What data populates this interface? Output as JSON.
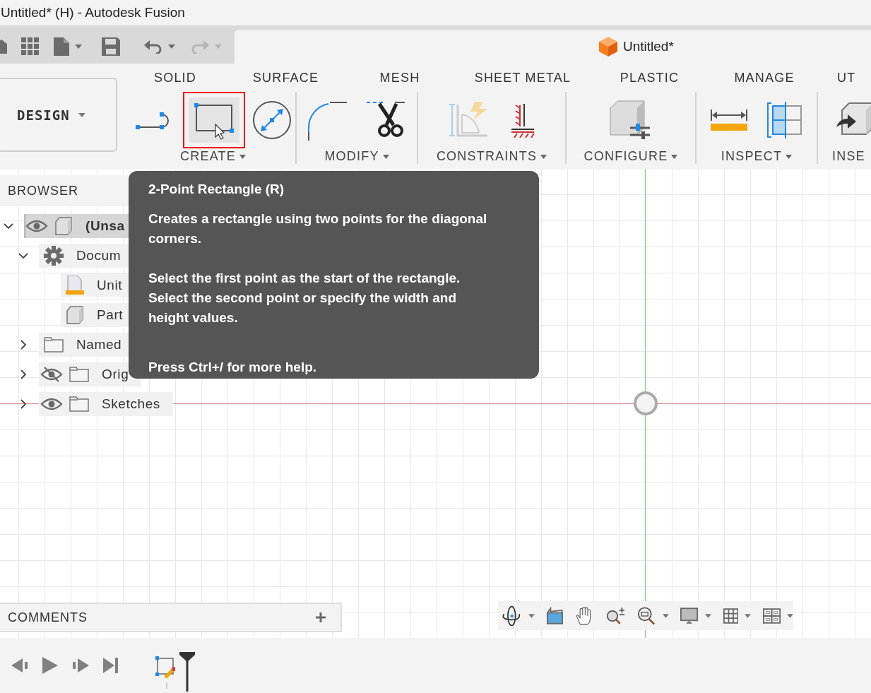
{
  "window": {
    "title": "Untitled* (H) - Autodesk Fusion"
  },
  "document_tab": {
    "title": "Untitled*"
  },
  "workspace": {
    "label": "DESIGN"
  },
  "ribbon_tabs": [
    {
      "label": "SOLID"
    },
    {
      "label": "SURFACE"
    },
    {
      "label": "MESH"
    },
    {
      "label": "SHEET METAL"
    },
    {
      "label": "PLASTIC"
    },
    {
      "label": "MANAGE"
    },
    {
      "label": "UT"
    }
  ],
  "tool_groups": [
    {
      "label": "CREATE",
      "menu": true,
      "tools": [
        {
          "kind": "line",
          "selected": false
        },
        {
          "kind": "rectangle",
          "selected": true
        },
        {
          "kind": "circle",
          "selected": false
        }
      ]
    },
    {
      "label": "MODIFY",
      "menu": true,
      "tools": [
        {
          "kind": "fillet",
          "selected": false
        },
        {
          "kind": "trim",
          "selected": false
        }
      ]
    },
    {
      "label": "CONSTRAINTS",
      "menu": true,
      "tools": [
        {
          "kind": "auto-constrain",
          "selected": false
        },
        {
          "kind": "fix",
          "selected": false
        }
      ]
    },
    {
      "label": "CONFIGURE",
      "menu": true,
      "tools": [
        {
          "kind": "configure",
          "selected": false
        }
      ]
    },
    {
      "label": "INSPECT",
      "menu": true,
      "tools": [
        {
          "kind": "measure",
          "selected": false
        },
        {
          "kind": "section",
          "selected": false
        }
      ]
    },
    {
      "label": "INSE",
      "menu": false,
      "tools": [
        {
          "kind": "insert",
          "selected": false
        }
      ]
    }
  ],
  "browser": {
    "title": "BROWSER",
    "tree": [
      {
        "label": "(Unsa",
        "kind": "component",
        "visible": true,
        "selected": true,
        "expanded": true,
        "children": [
          {
            "label": "Docum",
            "kind": "settings",
            "selected": false,
            "expanded": true,
            "children": [
              {
                "label": "Unit",
                "kind": "units",
                "selected": false
              },
              {
                "label": "Part",
                "kind": "part",
                "selected": false
              }
            ]
          },
          {
            "label": "Named",
            "kind": "folder",
            "selected": false,
            "expanded": false
          },
          {
            "label": "Orig",
            "kind": "folder",
            "visible": false,
            "selected": false,
            "expanded": false
          },
          {
            "label": "Sketches",
            "kind": "folder",
            "visible": true,
            "selected": false,
            "expanded": false
          }
        ]
      }
    ]
  },
  "tooltip": {
    "title": "2-Point Rectangle (R)",
    "description": "Creates a rectangle using two points for the diagonal corners.",
    "steps": [
      "Select the first point as the start of the rectangle.",
      "Select the second point or specify the width and height values."
    ],
    "help": "Press Ctrl+/ for more help."
  },
  "comments": {
    "title": "COMMENTS"
  }
}
